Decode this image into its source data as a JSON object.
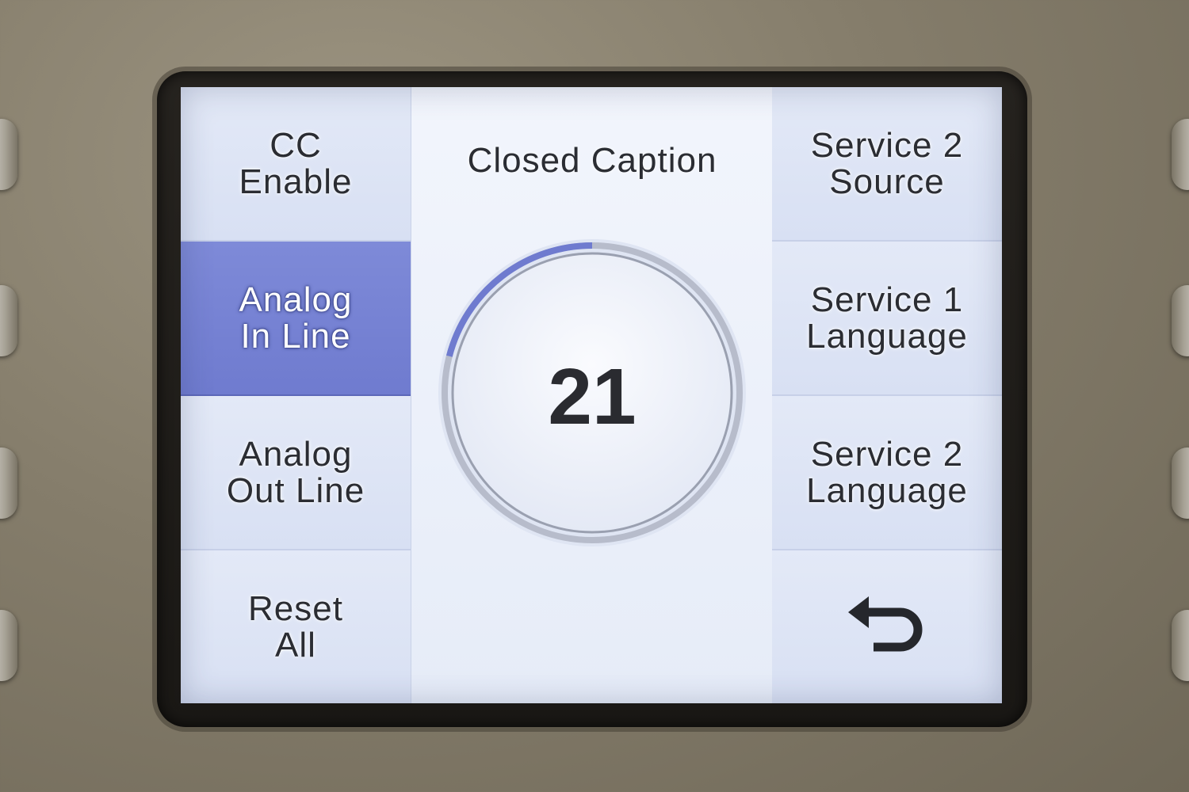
{
  "screen": {
    "title": "Closed Caption",
    "value": "21",
    "value_fraction": 0.21
  },
  "left_menu": [
    {
      "id": "cc-enable",
      "label": "CC\nEnable",
      "selected": false
    },
    {
      "id": "analog-in-line",
      "label": "Analog\nIn Line",
      "selected": true
    },
    {
      "id": "analog-out-line",
      "label": "Analog\nOut Line",
      "selected": false
    },
    {
      "id": "reset-all",
      "label": "Reset\nAll",
      "selected": false
    }
  ],
  "right_menu": [
    {
      "id": "service-2-source",
      "label": "Service 2\nSource"
    },
    {
      "id": "service-1-language",
      "label": "Service 1\nLanguage"
    },
    {
      "id": "service-2-language",
      "label": "Service 2\nLanguage"
    }
  ],
  "back_button": {
    "icon": "back-arrow-icon"
  },
  "colors": {
    "accent": "#6f7bcf",
    "screen_bg": "#e9eef9",
    "text": "#2b2d33"
  }
}
